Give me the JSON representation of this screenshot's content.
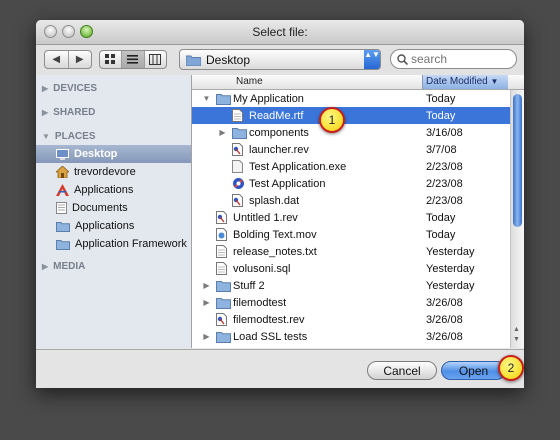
{
  "window": {
    "title": "Select file:"
  },
  "toolbar": {
    "back_glyph": "◀",
    "forward_glyph": "▶",
    "location": "Desktop",
    "location_arrows": "▲▼",
    "search_placeholder": "search"
  },
  "sidebar": {
    "sections": {
      "devices": "DEVICES",
      "shared": "SHARED",
      "places": "PLACES",
      "media": "MEDIA"
    },
    "places": [
      {
        "label": "Desktop",
        "icon": "desktop-icon",
        "selected": true
      },
      {
        "label": "trevordevore",
        "icon": "home-icon"
      },
      {
        "label": "Applications",
        "icon": "applications-icon"
      },
      {
        "label": "Documents",
        "icon": "documents-icon"
      },
      {
        "label": "Applications",
        "icon": "folder-icon"
      },
      {
        "label": "Application Framework",
        "icon": "folder-icon"
      }
    ]
  },
  "columns": {
    "name": "Name",
    "date": "Date Modified"
  },
  "files": [
    {
      "name": "My Application",
      "date": "Today",
      "level": 0,
      "type": "folder",
      "disclosure": "open"
    },
    {
      "name": "ReadMe.rtf",
      "date": "Today",
      "level": 1,
      "type": "doc",
      "selected": true
    },
    {
      "name": "components",
      "date": "3/16/08",
      "level": 1,
      "type": "folder",
      "disclosure": "closed"
    },
    {
      "name": "launcher.rev",
      "date": "3/7/08",
      "level": 1,
      "type": "rev"
    },
    {
      "name": "Test Application.exe",
      "date": "2/23/08",
      "level": 1,
      "type": "blank"
    },
    {
      "name": "Test Application",
      "date": "2/23/08",
      "level": 1,
      "type": "app"
    },
    {
      "name": "splash.dat",
      "date": "2/23/08",
      "level": 1,
      "type": "rev"
    },
    {
      "name": "Untitled 1.rev",
      "date": "Today",
      "level": 0,
      "type": "rev"
    },
    {
      "name": "Bolding Text.mov",
      "date": "Today",
      "level": 0,
      "type": "movie"
    },
    {
      "name": "release_notes.txt",
      "date": "Yesterday",
      "level": 0,
      "type": "doc"
    },
    {
      "name": "volusoni.sql",
      "date": "Yesterday",
      "level": 0,
      "type": "doc"
    },
    {
      "name": "Stuff 2",
      "date": "Yesterday",
      "level": 0,
      "type": "folder",
      "disclosure": "closed"
    },
    {
      "name": "filemodtest",
      "date": "3/26/08",
      "level": 0,
      "type": "folder",
      "disclosure": "closed"
    },
    {
      "name": "filemodtest.rev",
      "date": "3/26/08",
      "level": 0,
      "type": "rev"
    },
    {
      "name": "Load SSL tests",
      "date": "3/26/08",
      "level": 0,
      "type": "folder",
      "disclosure": "closed"
    }
  ],
  "buttons": {
    "cancel": "Cancel",
    "open": "Open"
  },
  "callouts": {
    "first": "1",
    "second": "2"
  },
  "colors": {
    "selection": "#3b75d9",
    "callout_fill": "#f5d400",
    "callout_ring": "#c81e1e"
  }
}
